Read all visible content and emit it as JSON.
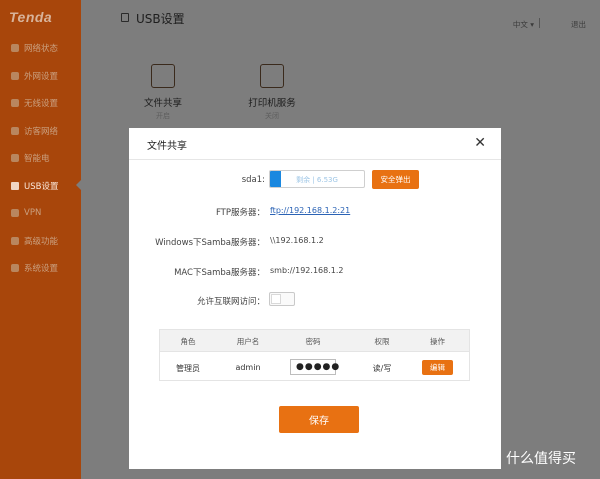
{
  "brand": {
    "logo": "Tenda",
    "accent_color": "#e87112",
    "sidebar_color": "#a8460b"
  },
  "sidebar": {
    "items": [
      {
        "label": "网络状态",
        "icon": "globe-icon"
      },
      {
        "label": "外网设置",
        "icon": "internet-icon"
      },
      {
        "label": "无线设置",
        "icon": "wifi-icon"
      },
      {
        "label": "访客网络",
        "icon": "guest-icon"
      },
      {
        "label": "智能电",
        "icon": "bulb-icon"
      },
      {
        "label": "USB设置",
        "icon": "usb-icon",
        "active": true
      },
      {
        "label": "VPN",
        "icon": "vpn-icon"
      },
      {
        "label": "高级功能",
        "icon": "tools-icon"
      },
      {
        "label": "系统设置",
        "icon": "gear-icon"
      }
    ]
  },
  "header": {
    "title": "USB设置",
    "language": "中文 ▾",
    "logout": "退出"
  },
  "services": [
    {
      "name": "文件共享",
      "status": "开启",
      "icon": "folder-share-icon"
    },
    {
      "name": "打印机服务",
      "status": "关闭",
      "icon": "printer-icon"
    }
  ],
  "modal": {
    "title": "文件共享",
    "close": "✕",
    "drive": {
      "label": "sda1:",
      "storage_text": "剩余 | 6.53G",
      "used_fraction": 0.12,
      "eject": "安全弹出"
    },
    "ftp": {
      "label": "FTP服务器：",
      "value": "ftp://192.168.1.2:21"
    },
    "samba_windows": {
      "label": "Windows下Samba服务器：",
      "value": "\\\\192.168.1.2"
    },
    "samba_mac": {
      "label": "MAC下Samba服务器：",
      "value": "smb://192.168.1.2"
    },
    "internet_access": {
      "label": "允许互联网访问：",
      "enabled": false
    },
    "table": {
      "headers": [
        "角色",
        "用户名",
        "密码",
        "权限",
        "操作"
      ],
      "rows": [
        {
          "role": "管理员",
          "username": "admin",
          "password": "●●●●●",
          "permission": "读/写",
          "action": "编辑"
        }
      ]
    },
    "save": "保存"
  },
  "watermark": {
    "text": "什么值得买",
    "icon_text": "值"
  }
}
